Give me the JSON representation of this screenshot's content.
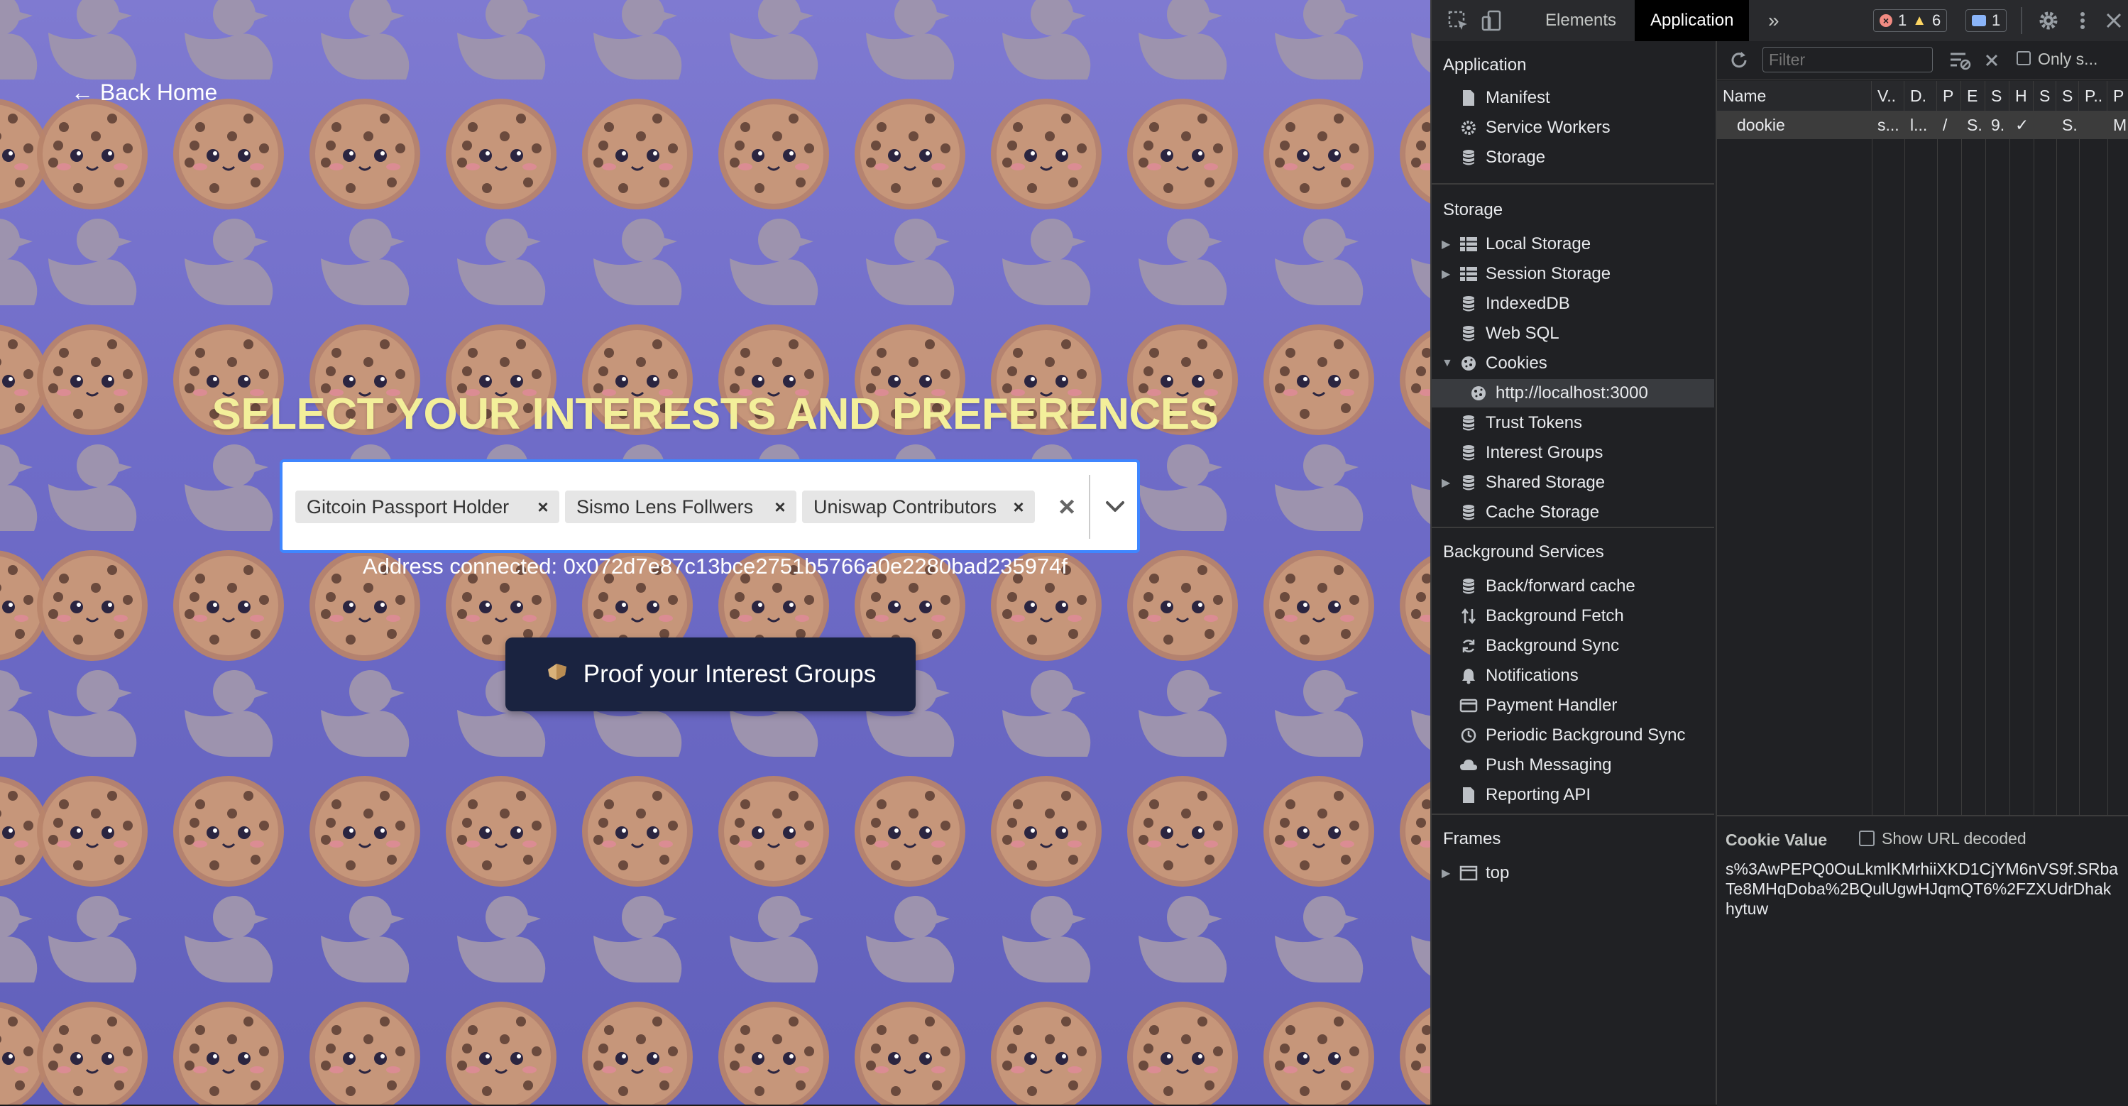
{
  "page": {
    "back_home": "← Back Home",
    "headline": "SELECT YOUR INTERESTS AND PREFERENCES",
    "selected_chips": [
      "Gitcoin Passport Holder",
      "Sismo Lens Follwers",
      "Uniswap Contributors"
    ],
    "chip_remove_glyph": "×",
    "clear_glyph": "×",
    "address_text": "Address connected: 0x072d7e87c13bce2751b5766a0e2280bad235974f",
    "proof_button": "Proof your Interest Groups",
    "colors": {
      "headline": "#f3ef9a",
      "background": "#6f6cc8",
      "button": "#1a2340",
      "select_border": "#3f86ff"
    }
  },
  "devtools": {
    "tabs": [
      "Elements",
      "Application"
    ],
    "active_tab": "Application",
    "more_tabs_glyph": "»",
    "errors": "1",
    "warnings": "6",
    "messages": "1",
    "sidebar": {
      "application": {
        "title": "Application",
        "items": [
          {
            "label": "Manifest",
            "icon": "file-icon"
          },
          {
            "label": "Service Workers",
            "icon": "gear-icon"
          },
          {
            "label": "Storage",
            "icon": "database-icon"
          }
        ]
      },
      "storage": {
        "title": "Storage",
        "items": [
          {
            "label": "Local Storage",
            "icon": "grid-icon",
            "arrow": "▶"
          },
          {
            "label": "Session Storage",
            "icon": "grid-icon",
            "arrow": "▶"
          },
          {
            "label": "IndexedDB",
            "icon": "database-icon",
            "arrow": ""
          },
          {
            "label": "Web SQL",
            "icon": "database-icon",
            "arrow": ""
          },
          {
            "label": "Cookies",
            "icon": "cookie-icon",
            "arrow": "▼"
          },
          {
            "label": "http://localhost:3000",
            "icon": "cookie-icon",
            "arrow": "",
            "selected": true,
            "indent": true
          },
          {
            "label": "Trust Tokens",
            "icon": "database-icon",
            "arrow": ""
          },
          {
            "label": "Interest Groups",
            "icon": "database-icon",
            "arrow": ""
          },
          {
            "label": "Shared Storage",
            "icon": "database-icon",
            "arrow": "▶"
          },
          {
            "label": "Cache Storage",
            "icon": "database-icon",
            "arrow": ""
          }
        ]
      },
      "background_services": {
        "title": "Background Services",
        "items": [
          {
            "label": "Back/forward cache",
            "icon": "database-icon"
          },
          {
            "label": "Background Fetch",
            "icon": "sort-arrows-icon"
          },
          {
            "label": "Background Sync",
            "icon": "sync-icon"
          },
          {
            "label": "Notifications",
            "icon": "bell-icon"
          },
          {
            "label": "Payment Handler",
            "icon": "card-icon"
          },
          {
            "label": "Periodic Background Sync",
            "icon": "clock-icon"
          },
          {
            "label": "Push Messaging",
            "icon": "cloud-icon"
          },
          {
            "label": "Reporting API",
            "icon": "file-icon"
          }
        ]
      },
      "frames": {
        "title": "Frames",
        "items": [
          {
            "label": "top",
            "icon": "frame-icon",
            "arrow": "▶"
          }
        ]
      }
    },
    "main": {
      "filter_placeholder": "Filter",
      "only_label": "Only s...",
      "columns": [
        "Name",
        "V..",
        "D.",
        "P",
        "E",
        "S",
        "H",
        "S",
        "S",
        "P..",
        "P"
      ],
      "row": [
        "dookie",
        "s...",
        "l...",
        "/",
        "S.",
        "9.",
        "✓",
        "",
        "S.",
        "",
        "M"
      ],
      "cookie_value_label": "Cookie Value",
      "show_url_decoded": "Show URL decoded",
      "cookie_value_lines": [
        "s%3AwPEPQ0OuLkmlKMrhiiXKD1CjYM6nVS9f.SRba",
        "Te8MHqDoba%2BQulUgwHJqmQT6%2FZXUdrDhak",
        "hytuw"
      ]
    }
  }
}
